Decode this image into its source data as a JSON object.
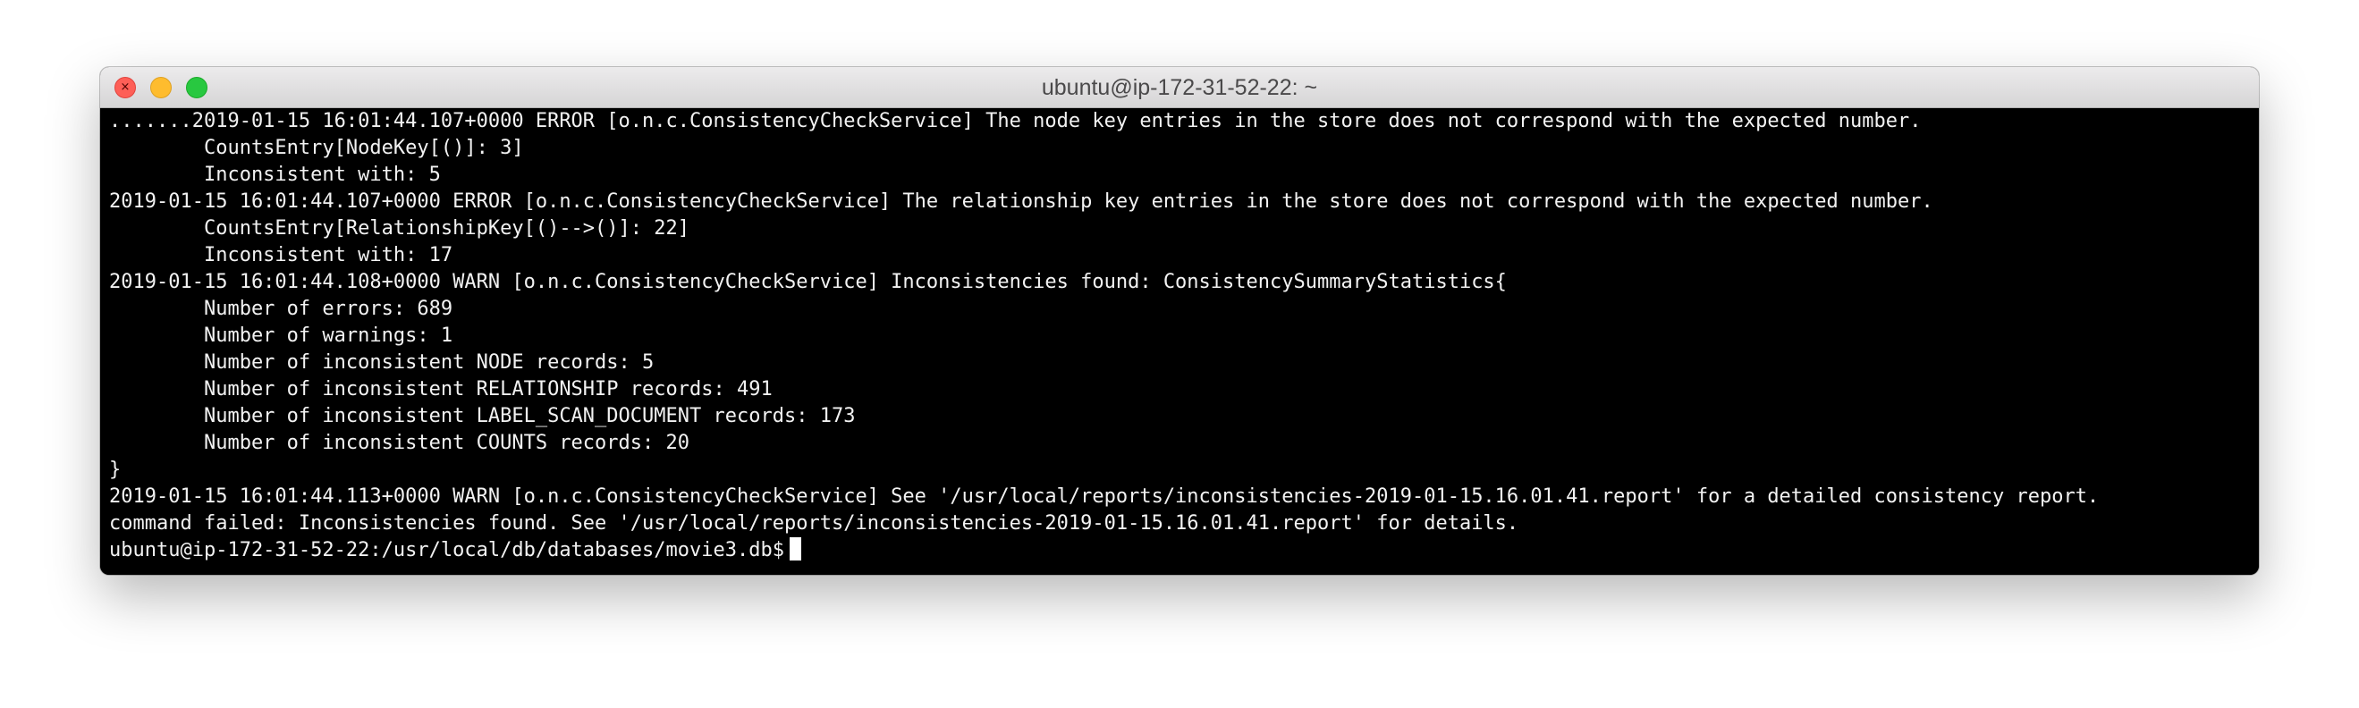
{
  "window": {
    "title": "ubuntu@ip-172-31-52-22: ~"
  },
  "traffic_lights": {
    "close_color": "#fe5f57",
    "minimize_color": "#febc2e",
    "zoom_color": "#28c840"
  },
  "terminal": {
    "lines": [
      ".......2019-01-15 16:01:44.107+0000 ERROR [o.n.c.ConsistencyCheckService] The node key entries in the store does not correspond with the expected number.",
      "        CountsEntry[NodeKey[()]: 3]",
      "        Inconsistent with: 5",
      "2019-01-15 16:01:44.107+0000 ERROR [o.n.c.ConsistencyCheckService] The relationship key entries in the store does not correspond with the expected number.",
      "        CountsEntry[RelationshipKey[()-->()]: 22]",
      "        Inconsistent with: 17",
      "2019-01-15 16:01:44.108+0000 WARN [o.n.c.ConsistencyCheckService] Inconsistencies found: ConsistencySummaryStatistics{",
      "        Number of errors: 689",
      "        Number of warnings: 1",
      "        Number of inconsistent NODE records: 5",
      "        Number of inconsistent RELATIONSHIP records: 491",
      "        Number of inconsistent LABEL_SCAN_DOCUMENT records: 173",
      "        Number of inconsistent COUNTS records: 20",
      "}",
      "2019-01-15 16:01:44.113+0000 WARN [o.n.c.ConsistencyCheckService] See '/usr/local/reports/inconsistencies-2019-01-15.16.01.41.report' for a detailed consistency report.",
      "command failed: Inconsistencies found. See '/usr/local/reports/inconsistencies-2019-01-15.16.01.41.report' for details."
    ],
    "prompt": "ubuntu@ip-172-31-52-22:/usr/local/db/databases/movie3.db$",
    "background_color": "#000000",
    "text_color": "#f2f2f2"
  }
}
